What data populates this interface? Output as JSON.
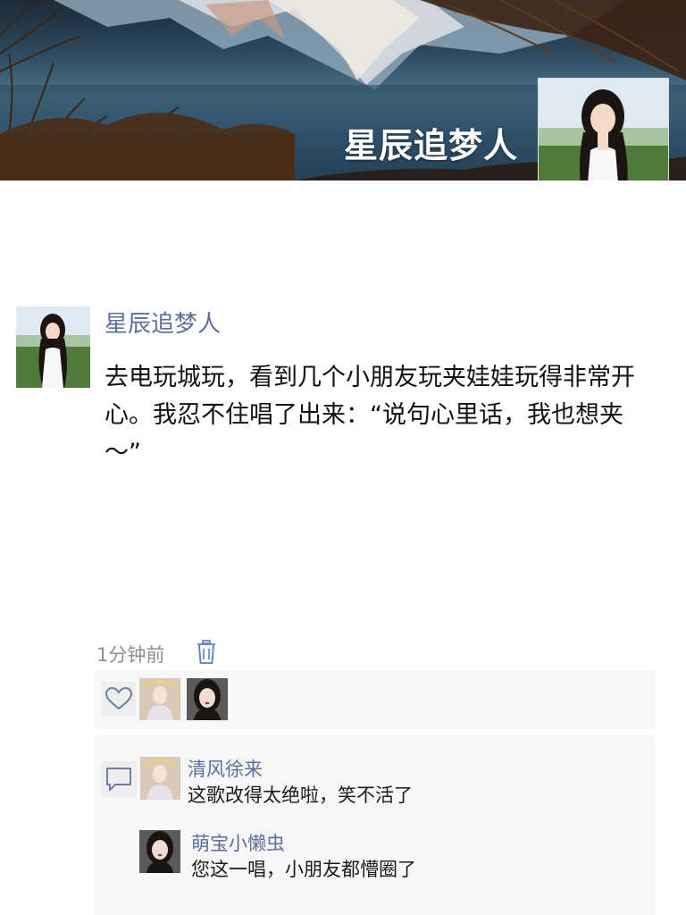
{
  "cover": {
    "title": "星辰追梦人"
  },
  "post": {
    "author": "星辰追梦人",
    "text": "去电玩城玩，看到几个小朋友玩夹娃娃玩得非常开心。我忍不住唱了出来：“说句心里话，我也想夹～”",
    "time": "1分钟前"
  },
  "likes": {
    "avatars": [
      "like-avatar-1",
      "like-avatar-2"
    ]
  },
  "comments": [
    {
      "name": "清风徐来",
      "text": "这歌改得太绝啦，笑不活了"
    },
    {
      "name": "萌宝小懒虫",
      "text": "您这一唱，小朋友都懵圈了"
    }
  ],
  "colors": {
    "link": "#5b6f9d",
    "meta": "#8e8e8e",
    "panel": "#f7f7f7"
  }
}
